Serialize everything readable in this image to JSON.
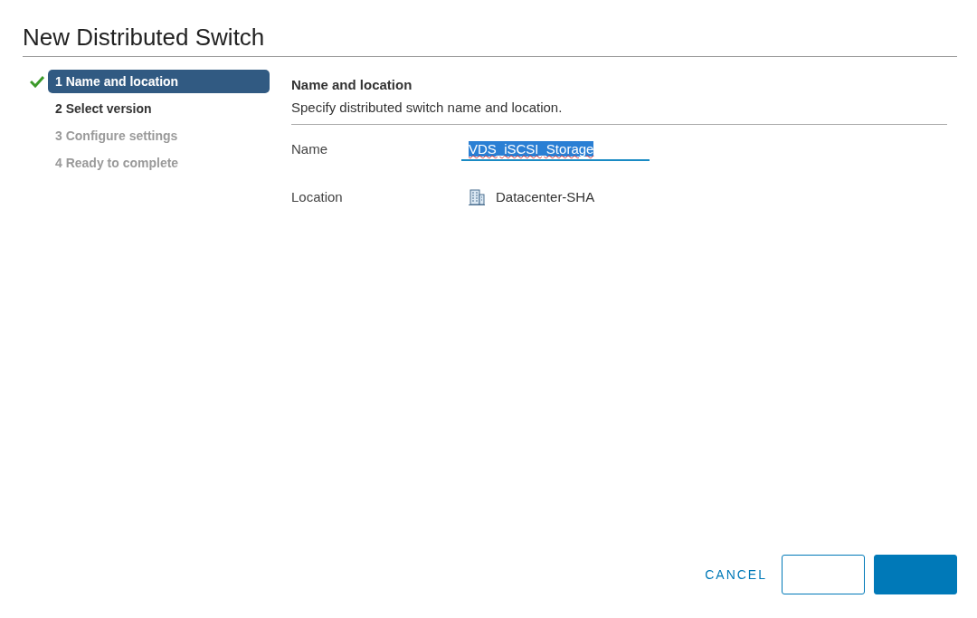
{
  "dialog": {
    "title": "New Distributed Switch"
  },
  "steps": [
    {
      "label": "1 Name and location",
      "selected": true,
      "done": true,
      "disabled": false
    },
    {
      "label": "2 Select version",
      "selected": false,
      "done": false,
      "disabled": false
    },
    {
      "label": "3 Configure settings",
      "selected": false,
      "done": false,
      "disabled": true
    },
    {
      "label": "4 Ready to complete",
      "selected": false,
      "done": false,
      "disabled": true
    }
  ],
  "page": {
    "heading": "Name and location",
    "description": "Specify distributed switch name and location.",
    "fields": [
      {
        "kind": "input",
        "label": "Name",
        "value": "VDS_iSCSI_Storage",
        "text_selected": true
      },
      {
        "kind": "location",
        "label": "Location",
        "value": "Datacenter-SHA"
      }
    ]
  },
  "buttons": [
    {
      "kind": "flat",
      "label": "CANCEL"
    },
    {
      "kind": "outline"
    },
    {
      "kind": "primary"
    }
  ]
}
